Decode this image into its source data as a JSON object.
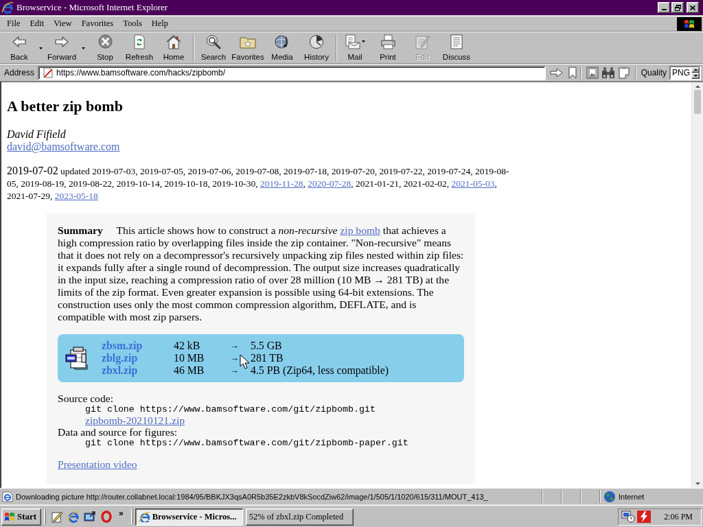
{
  "window": {
    "title": "Browservice - Microsoft Internet Explorer"
  },
  "menu": [
    "File",
    "Edit",
    "View",
    "Favorites",
    "Tools",
    "Help"
  ],
  "toolbar": {
    "groups": [
      [
        {
          "label": "Back",
          "kind": "split",
          "disabled": false
        },
        {
          "label": "Forward",
          "kind": "split",
          "disabled": false
        },
        {
          "label": "Stop",
          "kind": "plain",
          "disabled": false
        },
        {
          "label": "Refresh",
          "kind": "plain",
          "disabled": false
        },
        {
          "label": "Home",
          "kind": "plain",
          "disabled": false
        }
      ],
      [
        {
          "label": "Search",
          "kind": "plain",
          "disabled": false
        },
        {
          "label": "Favorites",
          "kind": "plain",
          "disabled": false
        },
        {
          "label": "Media",
          "kind": "plain",
          "disabled": false
        },
        {
          "label": "History",
          "kind": "plain",
          "disabled": false
        }
      ],
      [
        {
          "label": "Mail",
          "kind": "dropdown",
          "disabled": false
        },
        {
          "label": "Print",
          "kind": "plain",
          "disabled": false
        },
        {
          "label": "Edit",
          "kind": "plain",
          "disabled": true
        },
        {
          "label": "Discuss",
          "kind": "plain",
          "disabled": false
        }
      ]
    ]
  },
  "address_bar": {
    "label": "Address",
    "url": "https://www.bamsoftware.com/hacks/zipbomb/",
    "quality": {
      "label": "Quality",
      "value": "PNG"
    }
  },
  "page": {
    "heading": "A better zip bomb",
    "author": "David Fifield",
    "email": "david@bamsoftware.com",
    "dates": [
      {
        "kind": "large",
        "text": "2019-07-02"
      },
      {
        "kind": "text",
        "text": " updated 2019-07-03, 2019-07-05, 2019-07-06, 2019-07-08, 2019-07-18, 2019-07-20, 2019-07-22, 2019-07-24, 2019-08-05, 2019-08-19, 2019-08-22, 2019-10-14, 2019-10-18, 2019-10-30, "
      },
      {
        "kind": "link",
        "text": "2019-11-28"
      },
      {
        "kind": "text",
        "text": ", "
      },
      {
        "kind": "link",
        "text": "2020-07-28"
      },
      {
        "kind": "text",
        "text": ", 2021-01-21, 2021-02-02, "
      },
      {
        "kind": "link",
        "text": "2021-05-03"
      },
      {
        "kind": "text",
        "text": ", 2021-07-29, "
      },
      {
        "kind": "link",
        "text": "2023-05-18"
      }
    ],
    "summary": [
      {
        "kind": "heading",
        "text": "Summary"
      },
      {
        "kind": "text",
        "text": " This article shows how to construct a *non-recursive* "
      },
      {
        "kind": "link",
        "text": "zip bomb"
      },
      {
        "kind": "text",
        "text": " that achieves a high compression ratio by overlapping files inside the zip container. \"Non-recursive\" means that it does not rely on a decompressor's recursively unpacking zip files nested within zip files: it expands fully after a single round of decompression. The output size increases quadratically in the input size, reaching a compression ratio of over 28 million (10 MB → 281 TB) at the limits of the zip format. Even greater expansion is possible using 64-bit extensions. The construction uses only the most common compression algorithm, DEFLATE, and is compatible with most zip parsers."
      }
    ],
    "downloads": [
      {
        "name": "zbsm.zip",
        "size": "42 kB",
        "arrow": "→",
        "output": "5.5 GB"
      },
      {
        "name": "zblg.zip",
        "size": "10 MB",
        "arrow": "→",
        "output": "281 TB"
      },
      {
        "name": "zbxl.zip",
        "size": "46 MB",
        "arrow": "→",
        "output": "4.5 PB (Zip64, less compatible)"
      }
    ],
    "source": {
      "label": "Source code:",
      "command": "git clone https://www.bamsoftware.com/git/zipbomb.git",
      "archive": "zipbomb-20210121.zip"
    },
    "figures": {
      "label": "Data and source for figures:",
      "command": "git clone https://www.bamsoftware.com/git/zipbomb-paper.git"
    },
    "video": "Presentation video"
  },
  "status_bar": {
    "text": "Downloading picture http://router.collabnet.local:1984/95/BBKJX3qsA0R5b35E2zkbV8kSocdZiw62/image/1/505/1/1020/615/311/MOUT_413_",
    "zone": "Internet"
  },
  "taskbar": {
    "start": "Start",
    "more": "»",
    "tasks": [
      {
        "kind": "browser",
        "label": "Browservice - Micros...",
        "selected": true
      },
      {
        "kind": "download",
        "label": "52% of zbxl.zip Completed",
        "selected": false
      }
    ],
    "clock": "2:06 PM"
  }
}
